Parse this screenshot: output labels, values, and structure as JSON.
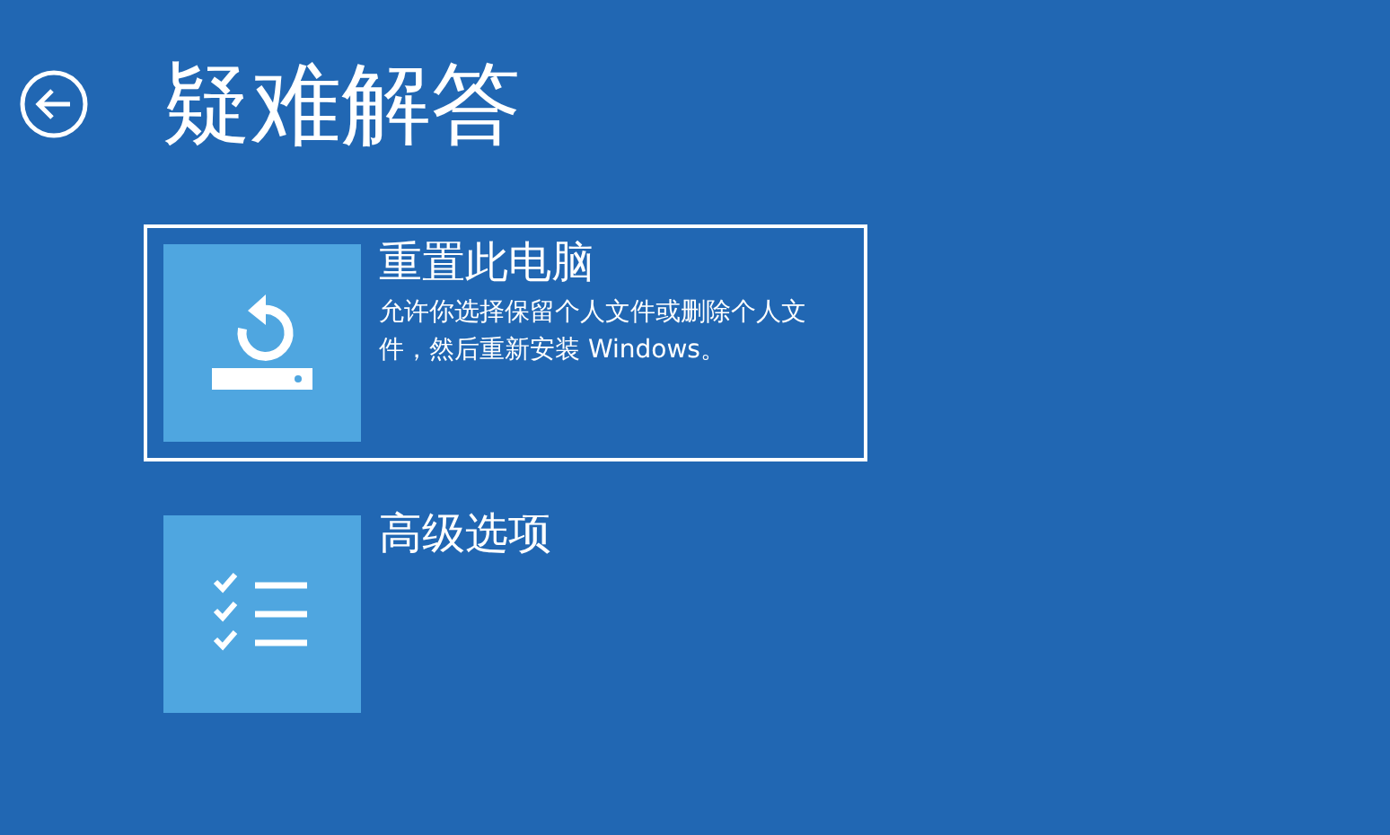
{
  "page": {
    "title": "疑难解答"
  },
  "options": [
    {
      "kind": "reset",
      "title": "重置此电脑",
      "description": "允许你选择保留个人文件或删除个人文件，然后重新安装 Windows。",
      "selected": true
    },
    {
      "kind": "advanced",
      "title": "高级选项",
      "selected": false
    }
  ]
}
